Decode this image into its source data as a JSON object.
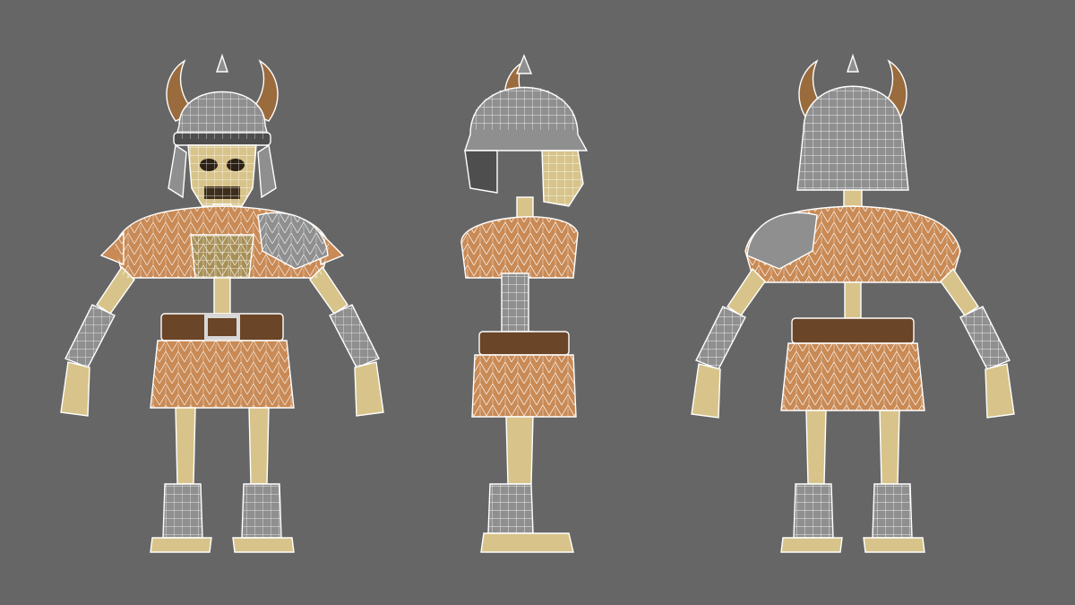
{
  "scene": {
    "background": "#666666",
    "wire_color": "#ffffff",
    "views": [
      {
        "name": "front",
        "subject": "skeleton-viking-character"
      },
      {
        "name": "side",
        "subject": "skeleton-viking-character"
      },
      {
        "name": "back",
        "subject": "skeleton-viking-character"
      }
    ],
    "palette": {
      "bone": "#d8c48a",
      "bone_shadow": "#a88f55",
      "fur": "#c98a55",
      "fur_dark": "#8a4f2a",
      "metal": "#8f8f8f",
      "metal_dark": "#4e4e4e",
      "horn": "#9a6b3d",
      "horn_tip": "#e7cf9a",
      "belt": "#6b4527",
      "buckle": "#b9b9b9"
    }
  }
}
